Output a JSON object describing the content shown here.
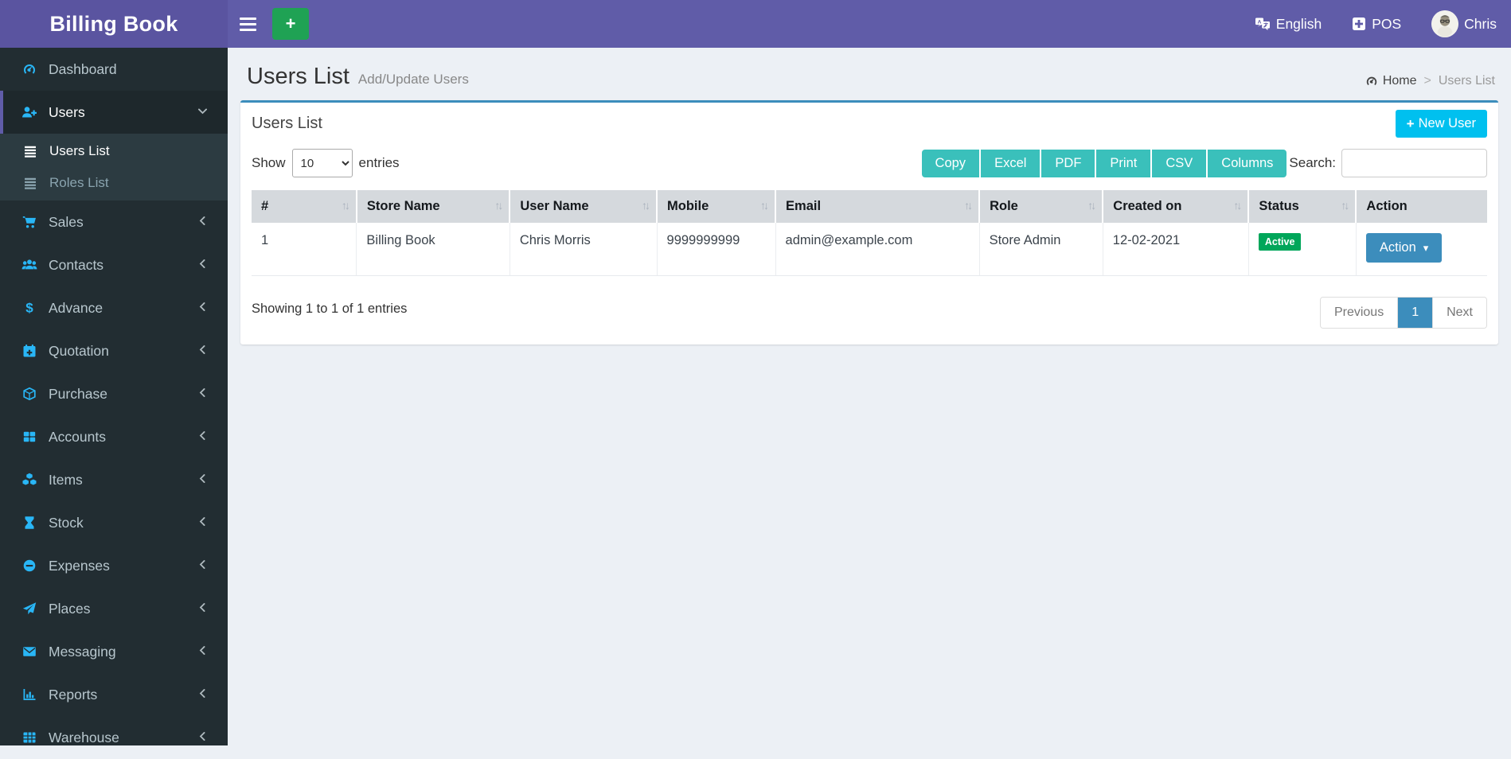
{
  "app": {
    "title": "Billing Book"
  },
  "topbar": {
    "language_label": "English",
    "pos_label": "POS",
    "user_name": "Chris"
  },
  "page": {
    "title": "Users List",
    "subtitle": "Add/Update Users",
    "breadcrumb": {
      "home_label": "Home",
      "separator": ">",
      "current": "Users List"
    }
  },
  "sidebar": {
    "items": [
      {
        "label": "Dashboard",
        "icon": "gauge-icon"
      },
      {
        "label": "Users",
        "icon": "user-plus-icon",
        "active": true,
        "expanded": true,
        "children": [
          {
            "label": "Users List",
            "icon": "list-icon",
            "active": true
          },
          {
            "label": "Roles List",
            "icon": "list-icon",
            "active": false
          }
        ]
      },
      {
        "label": "Sales",
        "icon": "cart-icon",
        "collapsible": true
      },
      {
        "label": "Contacts",
        "icon": "users-icon",
        "collapsible": true
      },
      {
        "label": "Advance",
        "icon": "dollar-icon",
        "collapsible": true
      },
      {
        "label": "Quotation",
        "icon": "calendar-plus-icon",
        "collapsible": true
      },
      {
        "label": "Purchase",
        "icon": "cube-icon",
        "collapsible": true
      },
      {
        "label": "Accounts",
        "icon": "grid-icon",
        "collapsible": true
      },
      {
        "label": "Items",
        "icon": "cubes-icon",
        "collapsible": true
      },
      {
        "label": "Stock",
        "icon": "hourglass-icon",
        "collapsible": true
      },
      {
        "label": "Expenses",
        "icon": "minus-circle-icon",
        "collapsible": true
      },
      {
        "label": "Places",
        "icon": "paper-plane-icon",
        "collapsible": true
      },
      {
        "label": "Messaging",
        "icon": "envelope-icon",
        "collapsible": true
      },
      {
        "label": "Reports",
        "icon": "bar-chart-icon",
        "collapsible": true
      },
      {
        "label": "Warehouse",
        "icon": "table-icon",
        "collapsible": true
      }
    ]
  },
  "card": {
    "title": "Users List",
    "new_user_label": "New User",
    "length_control": {
      "show_label": "Show",
      "selected": "10",
      "entries_label": "entries"
    },
    "export_buttons": [
      "Copy",
      "Excel",
      "PDF",
      "Print",
      "CSV",
      "Columns"
    ],
    "search_label": "Search:",
    "search_value": "",
    "table": {
      "columns": [
        "#",
        "Store Name",
        "User Name",
        "Mobile",
        "Email",
        "Role",
        "Created on",
        "Status",
        "Action"
      ],
      "rows": [
        {
          "cells": [
            "1",
            "Billing Book",
            "Chris Morris",
            "9999999999",
            "admin@example.com",
            "Store Admin",
            "12-02-2021"
          ],
          "status": "Active",
          "action_label": "Action"
        }
      ]
    },
    "footer": {
      "info": "Showing 1 to 1 of 1 entries",
      "pagination": {
        "previous": "Previous",
        "current": "1",
        "next": "Next"
      }
    }
  },
  "colors": {
    "brand_purple": "#605ca8",
    "sidebar_dark": "#222d32",
    "icon_cyan": "#29b6f6",
    "success_green": "#00a65a",
    "info_cyan": "#00c0ef",
    "export_teal": "#3ac0bb",
    "primary_blue": "#3c8dbc",
    "header_gray": "#d5d9dd",
    "page_bg": "#ecf0f5",
    "quick_add_green": "#1fa254"
  }
}
